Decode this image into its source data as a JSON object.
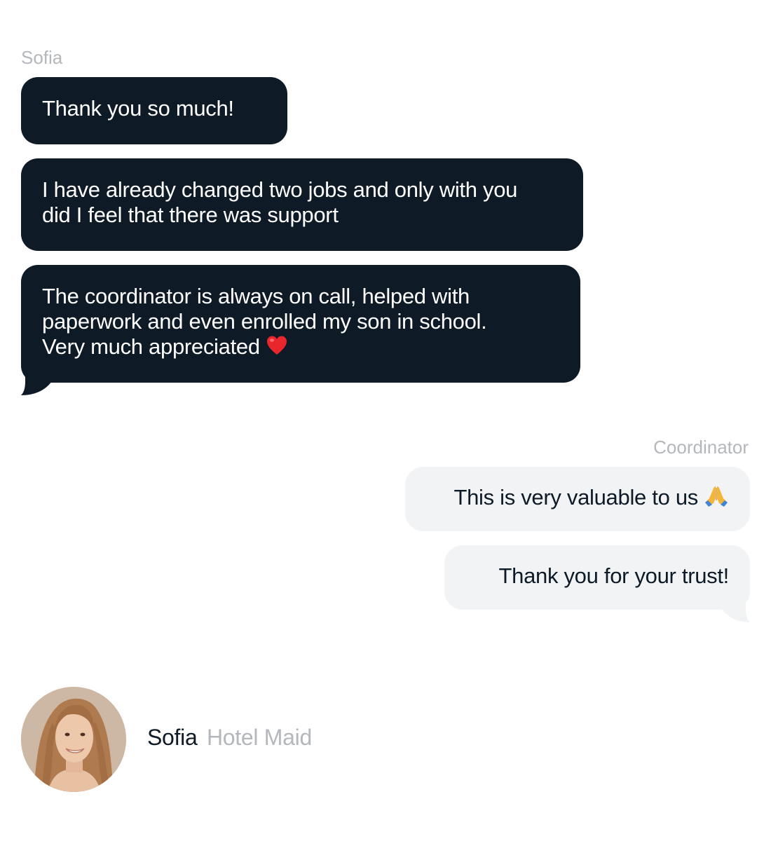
{
  "chat": {
    "left_sender": "Sofia",
    "right_sender": "Coordinator",
    "left_messages": [
      {
        "line1": "Thank you so much!"
      },
      {
        "line1": "I have already changed two jobs and only with you",
        "line2": "did I feel that there was support"
      },
      {
        "line1": "The coordinator is always on call, helped with",
        "line2": "paperwork and even enrolled my son in school.",
        "line3": "Very much appreciated",
        "emoji": "red-heart-icon"
      }
    ],
    "right_messages": [
      {
        "line1": "This is very valuable to us",
        "emoji": "folded-hands-icon"
      },
      {
        "line1": "Thank you for your trust!"
      }
    ]
  },
  "profile": {
    "name": "Sofia",
    "role": "Hotel Maid"
  },
  "colors": {
    "dark_bubble": "#0e1b27",
    "light_bubble": "#f2f3f4",
    "muted_text": "#b4b7bb"
  }
}
